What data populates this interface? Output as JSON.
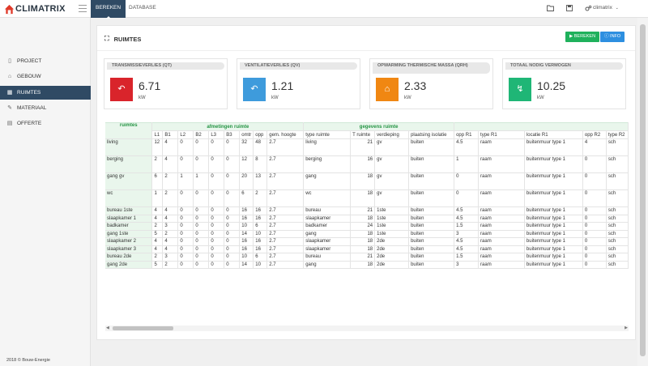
{
  "app": {
    "name": "CLIMATRIX"
  },
  "topbar": {
    "tabs": [
      {
        "label": "BEREKEN"
      },
      {
        "label": "DATABASE"
      }
    ],
    "user": "climatrix"
  },
  "sidebar": {
    "items": [
      {
        "label": "PROJECT",
        "icon": "project-icon"
      },
      {
        "label": "GEBOUW",
        "icon": "building-icon"
      },
      {
        "label": "RUIMTES",
        "icon": "rooms-icon",
        "active": true
      },
      {
        "label": "MATERIAAL",
        "icon": "tools-icon"
      },
      {
        "label": "OFFERTE",
        "icon": "document-icon"
      }
    ],
    "copyright": "2018 © Bouw-Energie"
  },
  "panel": {
    "title": "RUIMTES",
    "bereken_label": "BEREKEN",
    "info_label": "INFO"
  },
  "cards": [
    {
      "title": "TRANSMISSIEVERLIES (Qt)",
      "value": "6.71",
      "unit": "kW",
      "color": "#d9242b",
      "icon": "arrow-return-icon"
    },
    {
      "title": "VENTILATIEVERLIES (Qv)",
      "value": "1.21",
      "unit": "kW",
      "color": "#3e9bdc",
      "icon": "arrow-return-icon"
    },
    {
      "title": "OPWARMING THERMISCHE MASSA (Qrh)",
      "value": "2.33",
      "unit": "kW",
      "color": "#f08712",
      "icon": "home-icon"
    },
    {
      "title": "TOTAAL NODIG VERMOGEN",
      "value": "10.25",
      "unit": "kW",
      "color": "#1fb676",
      "icon": "bolt-icon"
    }
  ],
  "table": {
    "group_headers": [
      "ruimtes",
      "afmetingen ruimte",
      "gegevens ruimte",
      ""
    ],
    "columns": [
      "L1",
      "B1",
      "L2",
      "B2",
      "L3",
      "B3",
      "omtr",
      "opp",
      "gem. hoogte",
      "type ruimte",
      "T ruimte",
      "verdieping",
      "plaatsing isolatie",
      "opp R1",
      "type R1",
      "locatie R1",
      "opp R2",
      "type R2"
    ],
    "rows": [
      {
        "name": "living",
        "cells": [
          "12",
          "4",
          "0",
          "0",
          "0",
          "0",
          "32",
          "48",
          "2.7",
          "living",
          "21",
          "gv",
          "buiten",
          "4.5",
          "raam",
          "buitenmuur type 1",
          "4",
          "sch"
        ]
      },
      {
        "name": "berging",
        "cells": [
          "2",
          "4",
          "0",
          "0",
          "0",
          "0",
          "12",
          "8",
          "2.7",
          "berging",
          "16",
          "gv",
          "buiten",
          "1",
          "raam",
          "buitenmuur type 1",
          "0",
          "sch"
        ]
      },
      {
        "name": "gang gv",
        "cells": [
          "6",
          "2",
          "1",
          "1",
          "0",
          "0",
          "20",
          "13",
          "2.7",
          "gang",
          "18",
          "gv",
          "buiten",
          "0",
          "raam",
          "buitenmuur type 1",
          "0",
          "sch"
        ]
      },
      {
        "name": "wc",
        "cells": [
          "1",
          "2",
          "0",
          "0",
          "0",
          "0",
          "6",
          "2",
          "2.7",
          "wc",
          "18",
          "gv",
          "buiten",
          "0",
          "raam",
          "buitenmuur type 1",
          "0",
          "sch"
        ]
      },
      {
        "name": "bureau 1ste",
        "cells": [
          "4",
          "4",
          "0",
          "0",
          "0",
          "0",
          "16",
          "16",
          "2.7",
          "bureau",
          "21",
          "1ste",
          "buiten",
          "4.5",
          "raam",
          "buitenmuur type 1",
          "0",
          "sch"
        ]
      },
      {
        "name": "slaapkamer 1",
        "cells": [
          "4",
          "4",
          "0",
          "0",
          "0",
          "0",
          "16",
          "16",
          "2.7",
          "slaapkamer",
          "18",
          "1ste",
          "buiten",
          "4.5",
          "raam",
          "buitenmuur type 1",
          "0",
          "sch"
        ]
      },
      {
        "name": "badkamer",
        "cells": [
          "2",
          "3",
          "0",
          "0",
          "0",
          "0",
          "10",
          "6",
          "2.7",
          "badkamer",
          "24",
          "1ste",
          "buiten",
          "1.5",
          "raam",
          "buitenmuur type 1",
          "0",
          "sch"
        ]
      },
      {
        "name": "gang 1ste",
        "cells": [
          "5",
          "2",
          "0",
          "0",
          "0",
          "0",
          "14",
          "10",
          "2.7",
          "gang",
          "18",
          "1ste",
          "buiten",
          "3",
          "raam",
          "buitenmuur type 1",
          "0",
          "sch"
        ]
      },
      {
        "name": "slaapkamer 2",
        "cells": [
          "4",
          "4",
          "0",
          "0",
          "0",
          "0",
          "16",
          "16",
          "2.7",
          "slaapkamer",
          "18",
          "2de",
          "buiten",
          "4.5",
          "raam",
          "buitenmuur type 1",
          "0",
          "sch"
        ]
      },
      {
        "name": "slaapkamer 3",
        "cells": [
          "4",
          "4",
          "0",
          "0",
          "0",
          "0",
          "16",
          "16",
          "2.7",
          "slaapkamer",
          "18",
          "2de",
          "buiten",
          "4.5",
          "raam",
          "buitenmuur type 1",
          "0",
          "sch"
        ]
      },
      {
        "name": "bureau 2de",
        "cells": [
          "2",
          "3",
          "0",
          "0",
          "0",
          "0",
          "10",
          "6",
          "2.7",
          "bureau",
          "21",
          "2de",
          "buiten",
          "1.5",
          "raam",
          "buitenmuur type 1",
          "0",
          "sch"
        ]
      },
      {
        "name": "gang 2de",
        "cells": [
          "5",
          "2",
          "0",
          "0",
          "0",
          "0",
          "14",
          "10",
          "2.7",
          "gang",
          "18",
          "2de",
          "buiten",
          "3",
          "raam",
          "buitenmuur type 1",
          "0",
          "sch"
        ]
      }
    ]
  }
}
